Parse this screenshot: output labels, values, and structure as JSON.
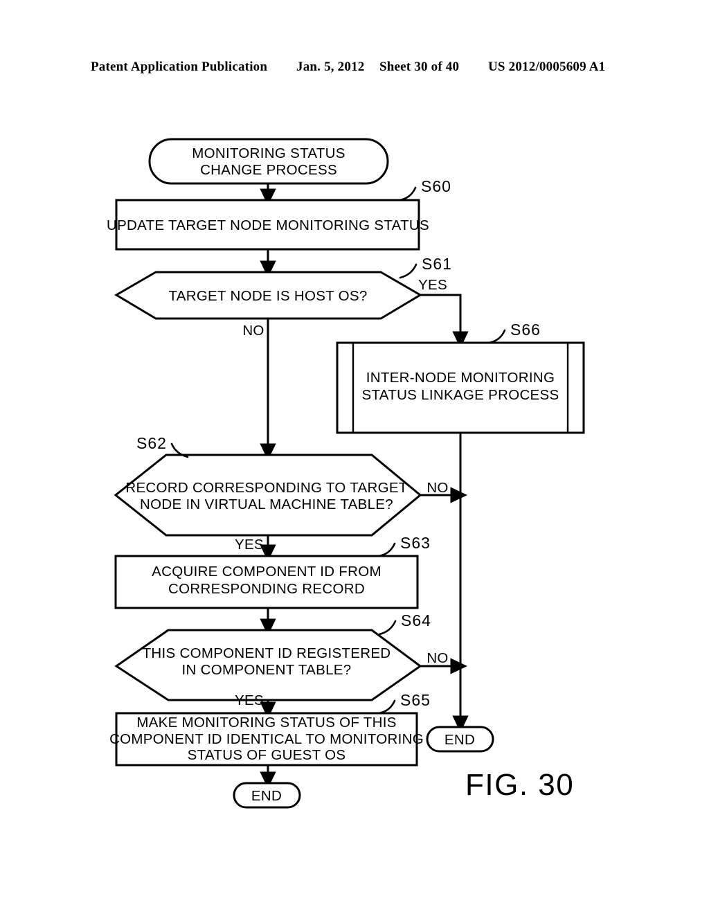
{
  "header": {
    "publication": "Patent Application Publication",
    "date": "Jan. 5, 2012",
    "sheet": "Sheet 30 of 40",
    "number": "US 2012/0005609 A1"
  },
  "figure": {
    "caption": "FIG. 30"
  },
  "chart_data": {
    "type": "flowchart",
    "title": "MONITORING STATUS CHANGE PROCESS",
    "nodes": [
      {
        "id": "start",
        "shape": "terminator",
        "step": "",
        "text": "MONITORING STATUS\nCHANGE PROCESS"
      },
      {
        "id": "s60",
        "shape": "process",
        "step": "S60",
        "text": "UPDATE TARGET NODE MONITORING STATUS"
      },
      {
        "id": "s61",
        "shape": "decision",
        "step": "S61",
        "text": "TARGET NODE IS HOST OS?"
      },
      {
        "id": "s66",
        "shape": "predefined-process",
        "step": "S66",
        "text": "INTER-NODE MONITORING\nSTATUS LINKAGE PROCESS"
      },
      {
        "id": "s62",
        "shape": "decision",
        "step": "S62",
        "text": "RECORD CORRESPONDING TO TARGET\nNODE IN VIRTUAL MACHINE TABLE?"
      },
      {
        "id": "s63",
        "shape": "process",
        "step": "S63",
        "text": "ACQUIRE COMPONENT ID FROM\nCORRESPONDING RECORD"
      },
      {
        "id": "s64",
        "shape": "decision",
        "step": "S64",
        "text": "THIS COMPONENT ID REGISTERED\nIN COMPONENT TABLE?"
      },
      {
        "id": "s65",
        "shape": "process",
        "step": "S65",
        "text": "MAKE MONITORING STATUS OF THIS\nCOMPONENT ID IDENTICAL TO MONITORING\nSTATUS OF GUEST OS"
      },
      {
        "id": "end1",
        "shape": "terminator",
        "step": "",
        "text": "END"
      },
      {
        "id": "end2",
        "shape": "terminator",
        "step": "",
        "text": "END"
      }
    ],
    "edges": [
      {
        "from": "start",
        "to": "s60",
        "label": ""
      },
      {
        "from": "s60",
        "to": "s61",
        "label": ""
      },
      {
        "from": "s61",
        "to": "s66",
        "label": "YES"
      },
      {
        "from": "s61",
        "to": "s62",
        "label": "NO"
      },
      {
        "from": "s66",
        "to": "end2",
        "label": ""
      },
      {
        "from": "s62",
        "to": "end2",
        "label": "NO"
      },
      {
        "from": "s62",
        "to": "s63",
        "label": "YES"
      },
      {
        "from": "s63",
        "to": "s64",
        "label": ""
      },
      {
        "from": "s64",
        "to": "end2",
        "label": "NO"
      },
      {
        "from": "s64",
        "to": "s65",
        "label": "YES"
      },
      {
        "from": "s65",
        "to": "end1",
        "label": ""
      }
    ]
  },
  "nodes": {
    "start": {
      "line1": "MONITORING STATUS",
      "line2": "CHANGE PROCESS"
    },
    "s60": {
      "step": "S60",
      "line1": "UPDATE TARGET NODE MONITORING STATUS"
    },
    "s61": {
      "step": "S61",
      "line1": "TARGET NODE IS HOST OS?",
      "yes": "YES",
      "no": "NO"
    },
    "s66": {
      "step": "S66",
      "line1": "INTER-NODE MONITORING",
      "line2": "STATUS LINKAGE PROCESS"
    },
    "s62": {
      "step": "S62",
      "line1": "RECORD CORRESPONDING TO TARGET",
      "line2": "NODE IN VIRTUAL MACHINE TABLE?",
      "yes": "YES",
      "no": "NO"
    },
    "s63": {
      "step": "S63",
      "line1": "ACQUIRE COMPONENT ID FROM",
      "line2": "CORRESPONDING RECORD"
    },
    "s64": {
      "step": "S64",
      "line1": "THIS COMPONENT ID REGISTERED",
      "line2": "IN COMPONENT TABLE?",
      "yes": "YES",
      "no": "NO"
    },
    "s65": {
      "step": "S65",
      "line1": "MAKE MONITORING STATUS OF THIS",
      "line2": "COMPONENT ID IDENTICAL TO MONITORING",
      "line3": "STATUS OF GUEST OS"
    },
    "end1": {
      "label": "END"
    },
    "end2": {
      "label": "END"
    }
  }
}
